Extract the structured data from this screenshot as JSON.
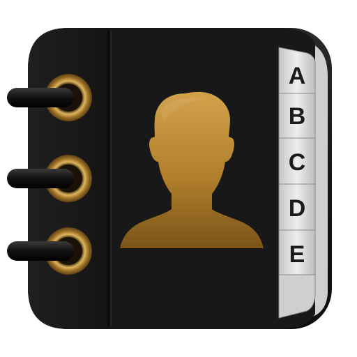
{
  "icon": {
    "tabs": [
      "A",
      "B",
      "C",
      "D",
      "E"
    ],
    "colors": {
      "cover": "#1a1a1a",
      "gold": "#b8862f",
      "tab": "#d6d6d6",
      "ring": "#c3963f"
    },
    "silhouette": "person-silhouette-icon"
  }
}
